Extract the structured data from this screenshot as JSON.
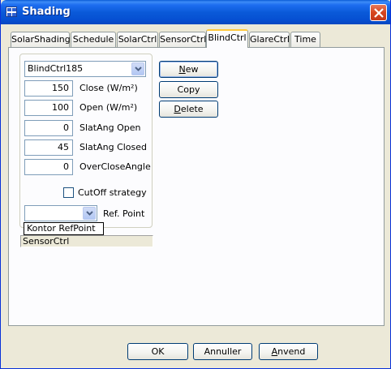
{
  "window": {
    "title": "Shading"
  },
  "tabs": [
    {
      "label": "SolarShading"
    },
    {
      "label": "Schedule"
    },
    {
      "label": "SolarCtrl"
    },
    {
      "label": "SensorCtrl"
    },
    {
      "label": "BlindCtrl",
      "active": true
    },
    {
      "label": "GlareCtrl"
    },
    {
      "label": "Time"
    }
  ],
  "blindctrl": {
    "selected_control": "BlindCtrl185",
    "close_value": "150",
    "close_label": "Close (W/m²)",
    "open_value": "100",
    "open_label": "Open (W/m²)",
    "slat_open_value": "0",
    "slat_open_label": "SlatAng Open",
    "slat_closed_value": "45",
    "slat_closed_label": "SlatAng Closed",
    "overclose_value": "0",
    "overclose_label": "OverCloseAngle",
    "cutoff_label": "CutOff strategy",
    "cutoff_checked": false,
    "refpoint_label": "Ref. Point",
    "refpoint_tooltip": "Kontor RefPoint",
    "sensor_field": "SensorCtrl"
  },
  "actions": {
    "new_label_prefix": "",
    "new_accel": "N",
    "new_rest": "ew",
    "copy_label": "Copy",
    "delete_accel": "D",
    "delete_rest": "elete"
  },
  "footer": {
    "ok_label": "OK",
    "cancel_label": "Annuller",
    "apply_accel": "A",
    "apply_rest": "nvend"
  },
  "colors": {
    "titlebar": "#0a5ad9",
    "tab_highlight": "#ffc83c",
    "dialog_bg": "#ece9d8",
    "panel_bg": "#fcfcfe"
  }
}
